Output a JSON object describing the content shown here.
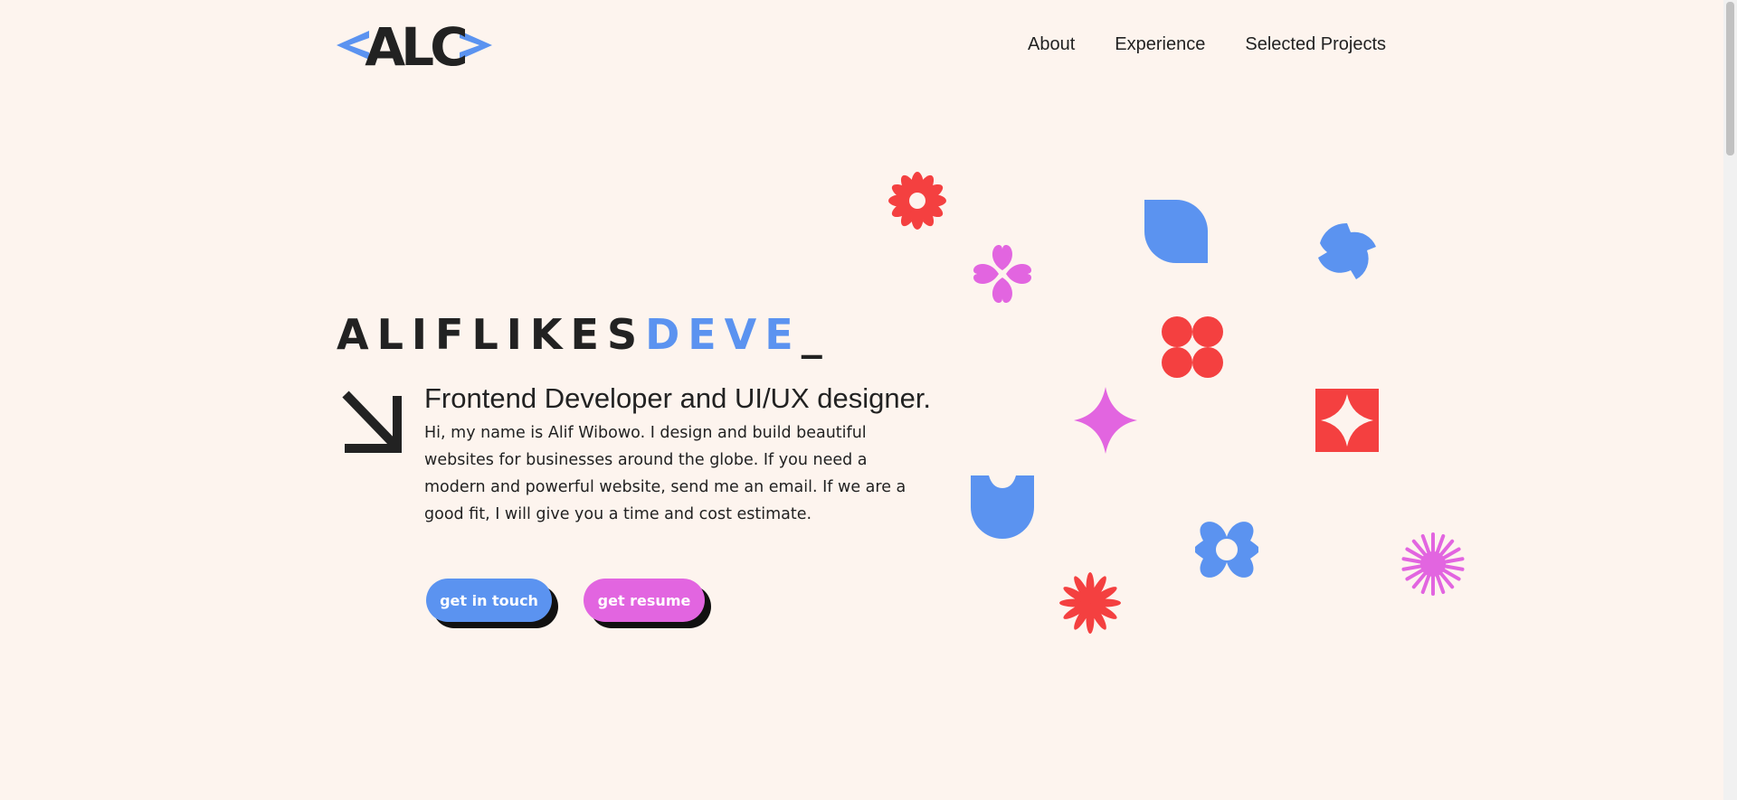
{
  "logo": {
    "text": "ALC",
    "alt": "logo"
  },
  "nav": {
    "about": "About",
    "experience": "Experience",
    "projects": "Selected Projects"
  },
  "hero": {
    "typed_dark": "ALIFLIKES",
    "typed_blue": "DEVE",
    "cursor": "_",
    "headline": "Frontend Developer and UI/UX designer.",
    "intro": "Hi, my name is Alif Wibowo. I design and build beautiful websites for businesses around the globe. If you need a modern and powerful website, send me an email. If we are a good fit, I will give you a time and cost estimate."
  },
  "buttons": {
    "touch": "get in touch",
    "resume": "get resume"
  },
  "colors": {
    "blue": "#5b93f0",
    "pink": "#e265e0",
    "red": "#f44040",
    "dark": "#222222",
    "background": "#fdf4ee"
  },
  "icons": [
    "arrow-down-right-icon",
    "red-flower-icon",
    "pink-heart-clover-icon",
    "blue-leaf-icon",
    "blue-swirl-icon",
    "red-four-circles-icon",
    "pink-sparkle-icon",
    "red-sparkle-square-icon",
    "blue-tulip-icon",
    "blue-flower-icon",
    "red-starburst-icon",
    "pink-starburst-icon"
  ]
}
